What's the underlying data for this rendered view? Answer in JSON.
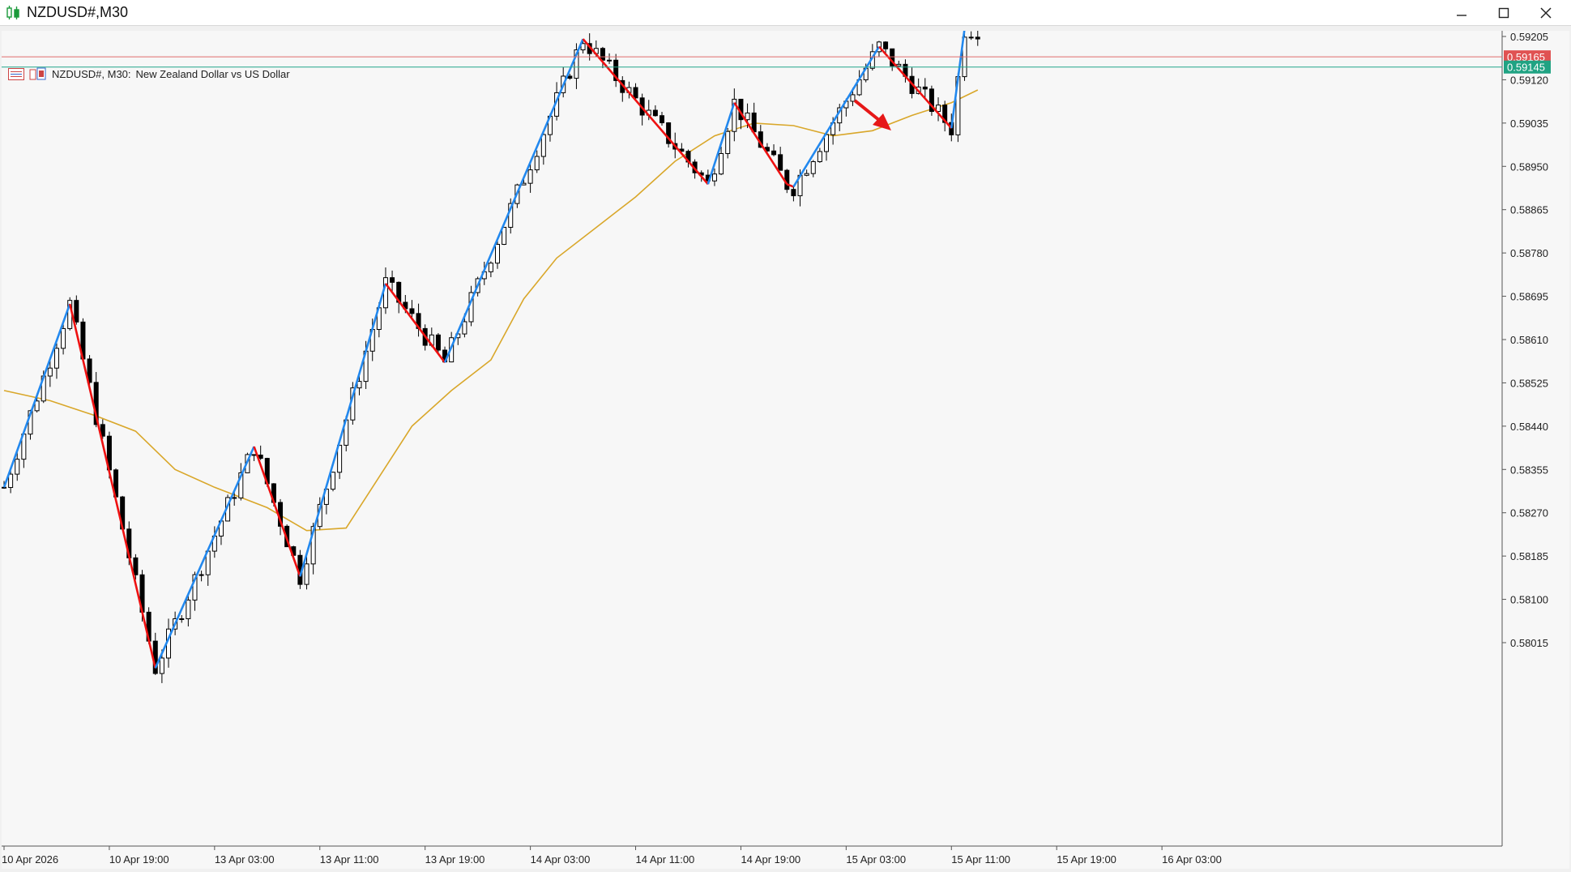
{
  "window": {
    "title": "NZDUSD#,M30",
    "controls": [
      "minimize",
      "maximize",
      "close"
    ]
  },
  "chart_header": {
    "symbol_timeframe": "NZDUSD#, M30:",
    "description": "New Zealand Dollar vs US Dollar"
  },
  "colors": {
    "zigzag_up": "#2288ee",
    "zigzag_down": "#ee1111",
    "moving_average": "#d9a72a",
    "bid_line": "#e06c6c",
    "ask_line": "#22a58a",
    "bid_tag": "#e05252",
    "ask_tag": "#20a383",
    "bull_candle": "#ffffff",
    "bear_candle": "#000000"
  },
  "price_tags": {
    "bid": "0.59165",
    "ask": "0.59145"
  },
  "chart_data": {
    "type": "candlestick",
    "symbol": "NZDUSD#",
    "timeframe": "M30",
    "y_ticks": [
      "0.59205",
      "0.59120",
      "0.59035",
      "0.58950",
      "0.58865",
      "0.58780",
      "0.58695",
      "0.58610",
      "0.58525",
      "0.58440",
      "0.58355",
      "0.58270",
      "0.58185",
      "0.58100",
      "0.58015"
    ],
    "x_ticks": [
      "10 Apr 2026",
      "10 Apr 19:00",
      "13 Apr 03:00",
      "13 Apr 11:00",
      "13 Apr 19:00",
      "14 Apr 03:00",
      "14 Apr 11:00",
      "14 Apr 19:00",
      "15 Apr 03:00",
      "15 Apr 11:00",
      "15 Apr 19:00",
      "16 Apr 03:00"
    ],
    "ylim": [
      0.5795,
      0.5923
    ],
    "bid": 0.59165,
    "ask": 0.59145,
    "zigzag": [
      {
        "bar": 0,
        "price": 0.5832
      },
      {
        "bar": 10,
        "price": 0.5868
      },
      {
        "bar": 23,
        "price": 0.57965
      },
      {
        "bar": 38,
        "price": 0.584
      },
      {
        "bar": 45,
        "price": 0.58145
      },
      {
        "bar": 58,
        "price": 0.5872
      },
      {
        "bar": 67,
        "price": 0.58565
      },
      {
        "bar": 88,
        "price": 0.592
      },
      {
        "bar": 107,
        "price": 0.58915
      },
      {
        "bar": 111,
        "price": 0.59075
      },
      {
        "bar": 119,
        "price": 0.58915
      },
      {
        "bar": 120,
        "price": 0.5891
      },
      {
        "bar": 133,
        "price": 0.59185
      },
      {
        "bar": 144,
        "price": 0.59025
      },
      {
        "bar": 146,
        "price": 0.5922
      }
    ],
    "moving_average": [
      {
        "bar": 0,
        "price": 0.5851
      },
      {
        "bar": 7,
        "price": 0.5849
      },
      {
        "bar": 14,
        "price": 0.5846
      },
      {
        "bar": 20,
        "price": 0.5843
      },
      {
        "bar": 26,
        "price": 0.58355
      },
      {
        "bar": 32,
        "price": 0.5832
      },
      {
        "bar": 40,
        "price": 0.5828
      },
      {
        "bar": 46,
        "price": 0.58235
      },
      {
        "bar": 52,
        "price": 0.5824
      },
      {
        "bar": 56,
        "price": 0.5832
      },
      {
        "bar": 62,
        "price": 0.5844
      },
      {
        "bar": 68,
        "price": 0.5851
      },
      {
        "bar": 74,
        "price": 0.5857
      },
      {
        "bar": 79,
        "price": 0.5869
      },
      {
        "bar": 84,
        "price": 0.5877
      },
      {
        "bar": 90,
        "price": 0.5883
      },
      {
        "bar": 96,
        "price": 0.5889
      },
      {
        "bar": 102,
        "price": 0.5896
      },
      {
        "bar": 108,
        "price": 0.5901
      },
      {
        "bar": 114,
        "price": 0.59035
      },
      {
        "bar": 120,
        "price": 0.5903
      },
      {
        "bar": 126,
        "price": 0.5901
      },
      {
        "bar": 132,
        "price": 0.5902
      },
      {
        "bar": 138,
        "price": 0.5905
      },
      {
        "bar": 144,
        "price": 0.59075
      },
      {
        "bar": 148,
        "price": 0.591
      }
    ]
  }
}
